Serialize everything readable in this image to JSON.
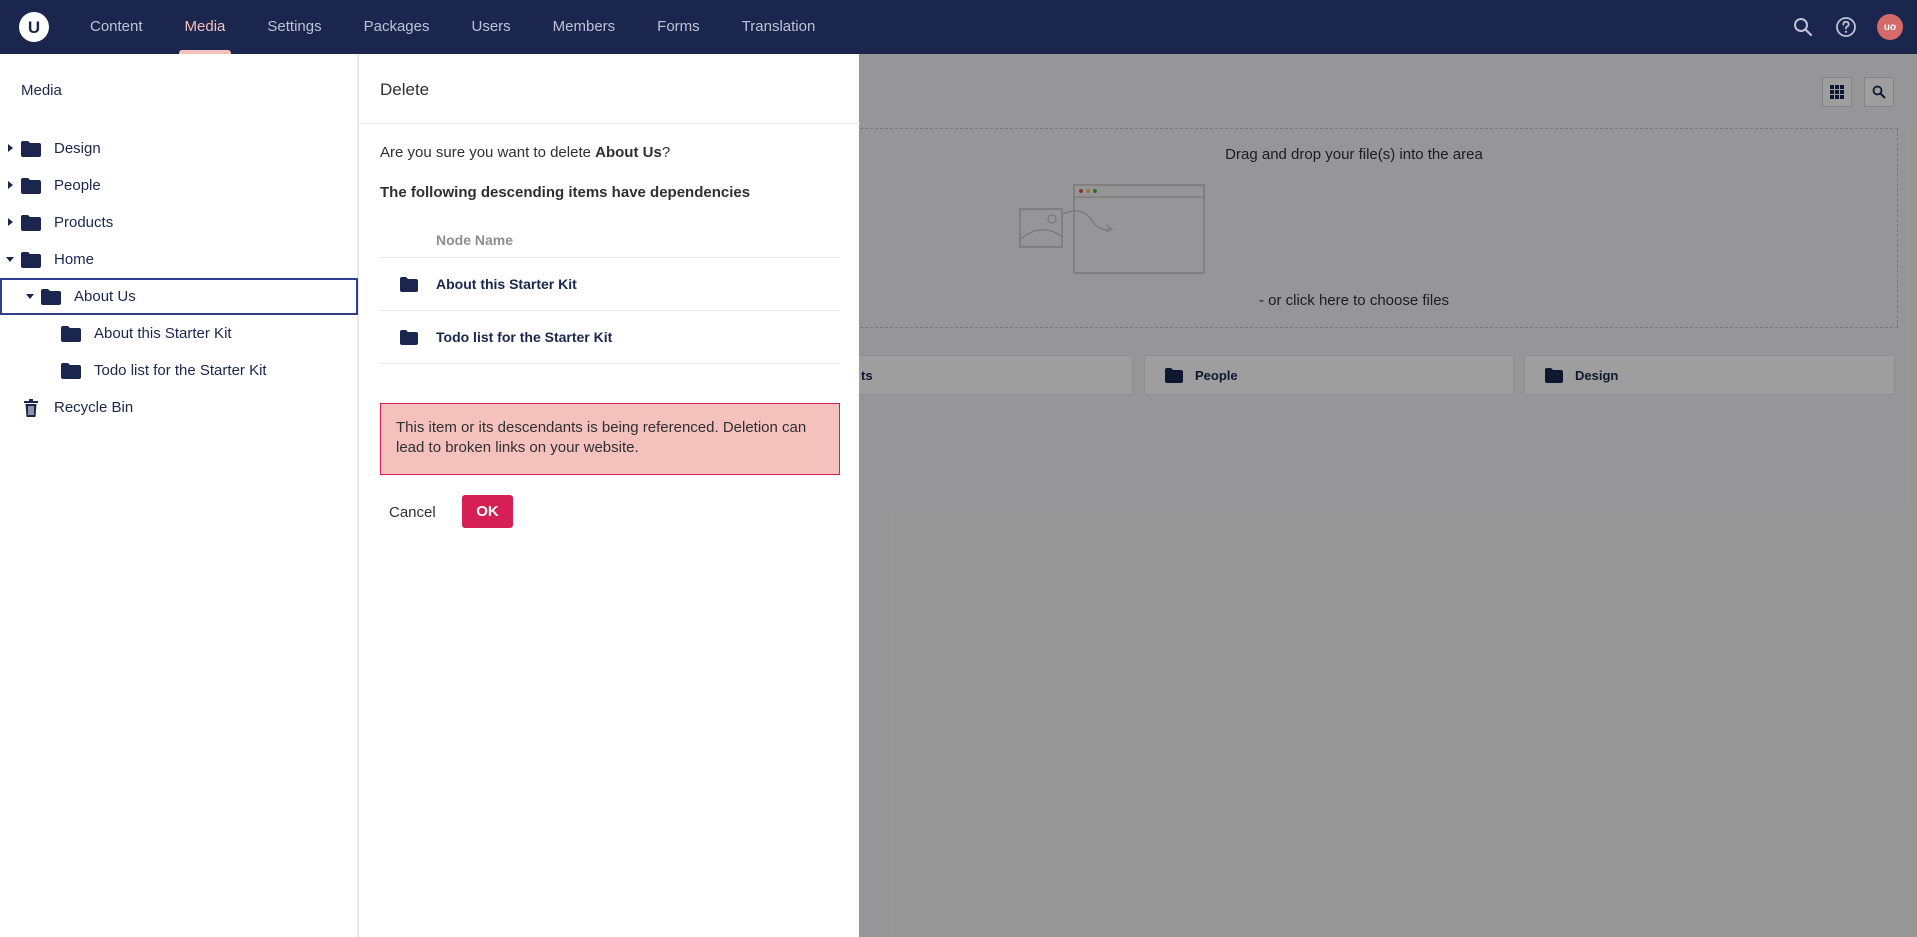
{
  "header": {
    "logo_letter": "U",
    "nav": [
      "Content",
      "Media",
      "Settings",
      "Packages",
      "Users",
      "Members",
      "Forms",
      "Translation"
    ],
    "active_nav": "Media",
    "avatar_initials": "uo"
  },
  "sidebar": {
    "title": "Media",
    "items": [
      {
        "label": "Design",
        "icon": "folder-icon",
        "caret": "right"
      },
      {
        "label": "People",
        "icon": "folder-icon",
        "caret": "right"
      },
      {
        "label": "Products",
        "icon": "folder-icon",
        "caret": "right"
      },
      {
        "label": "Home",
        "icon": "folder-icon",
        "caret": "down"
      },
      {
        "label": "About Us",
        "icon": "folder-icon",
        "caret": "down",
        "selected": true
      },
      {
        "label": "About this Starter Kit",
        "icon": "folder-icon"
      },
      {
        "label": "Todo list for the Starter Kit",
        "icon": "folder-icon"
      },
      {
        "label": "Recycle Bin",
        "icon": "trash-icon"
      }
    ]
  },
  "main": {
    "dropzone_title": "Drag and drop your file(s) into the area",
    "dropzone_link": "- or click here to choose files",
    "folders": [
      "ts",
      "People",
      "Design"
    ]
  },
  "dialog": {
    "title": "Delete",
    "question_prefix": "Are you sure you want to delete ",
    "item_name": "About Us",
    "question_suffix": "?",
    "dependencies_heading": "The following descending items have dependencies",
    "table_header": "Node Name",
    "rows": [
      "About this Starter Kit",
      "Todo list for the Starter Kit"
    ],
    "warning": "This item or its descendants is being referenced. Deletion can lead to broken links on your website.",
    "cancel_label": "Cancel",
    "ok_label": "OK"
  },
  "colors": {
    "header_bg": "#1b264f",
    "active_nav": "#f5c1bc",
    "ok_button": "#d42054",
    "warning_bg": "#f5c1bc",
    "warning_border": "#d42054"
  }
}
